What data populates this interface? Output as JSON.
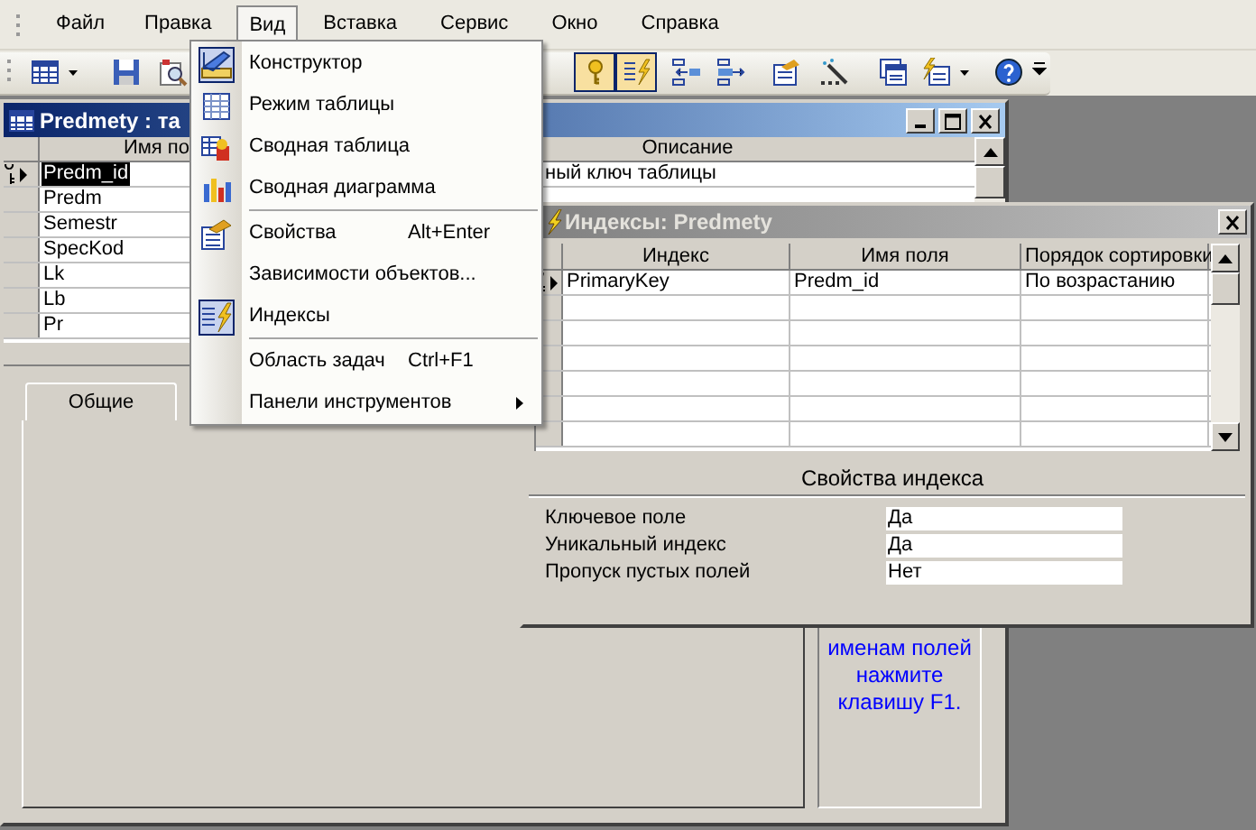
{
  "menu_bar": [
    {
      "label": "Файл",
      "selected": false
    },
    {
      "label": "Правка",
      "selected": false
    },
    {
      "label": "Вид",
      "selected": true
    },
    {
      "label": "Вставка",
      "selected": false
    },
    {
      "label": "Сервис",
      "selected": false
    },
    {
      "label": "Окно",
      "selected": false
    },
    {
      "label": "Справка",
      "selected": false
    }
  ],
  "toolbar": [
    {
      "pressed": false
    },
    {
      "pressed": false
    },
    {
      "pressed": false
    },
    {
      "pressed": true
    },
    {
      "pressed": true
    },
    {
      "pressed": false
    },
    {
      "pressed": false
    },
    {
      "pressed": false
    },
    {
      "pressed": false
    },
    {
      "pressed": false
    },
    {
      "pressed": false
    },
    {
      "pressed": false
    }
  ],
  "table_window": {
    "title": "Predmety : та",
    "columns": [
      "Имя по",
      "Описание"
    ],
    "rows": [
      {
        "name": "Predm_id",
        "description": "ный ключ таблицы",
        "selected": true,
        "primary_key": true
      },
      {
        "name": "Predm",
        "selected": false,
        "primary_key": false
      },
      {
        "name": "Semestr",
        "selected": false,
        "primary_key": false
      },
      {
        "name": "SpecKod",
        "selected": false,
        "primary_key": false
      },
      {
        "name": "Lk",
        "selected": false,
        "primary_key": false
      },
      {
        "name": "Lb",
        "selected": false,
        "primary_key": false
      },
      {
        "name": "Pr",
        "selected": false,
        "primary_key": false
      }
    ],
    "tabs": [
      {
        "label": "Общие",
        "selected": true
      }
    ],
    "help_lines": [
      "именам полей",
      "нажмите",
      "клавишу F1."
    ]
  },
  "view_menu": [
    {
      "kind": "item",
      "label": "Конструктор",
      "checked": true,
      "submenu": false
    },
    {
      "kind": "item",
      "label": "Режим таблицы",
      "checked": false,
      "submenu": false
    },
    {
      "kind": "item",
      "label": "Сводная таблица",
      "checked": false,
      "submenu": false
    },
    {
      "kind": "item",
      "label": "Сводная диаграмма",
      "checked": false,
      "submenu": false
    },
    {
      "kind": "separator"
    },
    {
      "kind": "item",
      "label": "Свойства",
      "shortcut": "Alt+Enter",
      "checked": false,
      "submenu": false
    },
    {
      "kind": "item",
      "label": "Зависимости объектов...",
      "checked": false,
      "submenu": false
    },
    {
      "kind": "item",
      "label": "Индексы",
      "checked": true,
      "submenu": false
    },
    {
      "kind": "separator"
    },
    {
      "kind": "item",
      "label": "Область задач",
      "shortcut": "Ctrl+F1",
      "checked": false,
      "submenu": false
    },
    {
      "kind": "item",
      "label": "Панели инструментов",
      "checked": false,
      "submenu": true
    }
  ],
  "indexes_dialog": {
    "title": "Индексы: Predmety",
    "columns": [
      "Индекс",
      "Имя поля",
      "Порядок сортировки"
    ],
    "rows": [
      {
        "index": "PrimaryKey",
        "field": "Predm_id",
        "sort": "По возрастанию",
        "current": true,
        "primary_key": true
      }
    ],
    "properties_title": "Свойства индекса",
    "properties": [
      {
        "label": "Ключевое поле",
        "value": "Да"
      },
      {
        "label": "Уникальный индекс",
        "value": "Да"
      },
      {
        "label": "Пропуск пустых полей",
        "value": "Нет"
      }
    ]
  }
}
